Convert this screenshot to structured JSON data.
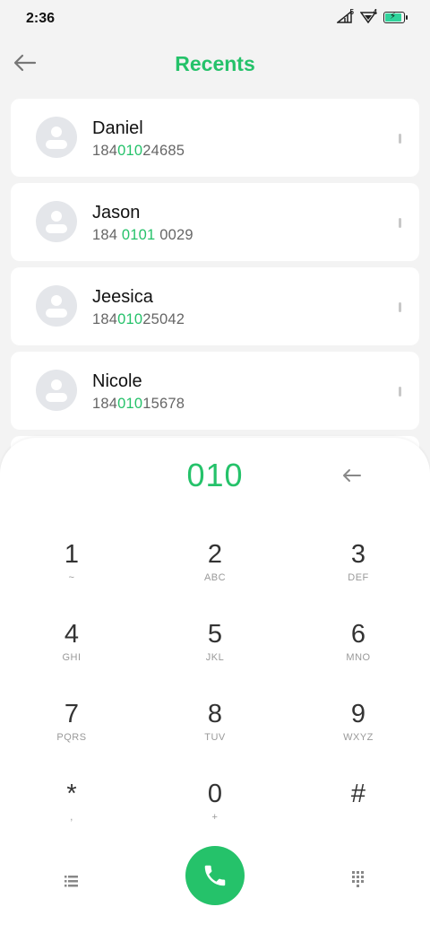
{
  "status": {
    "time": "2:36",
    "sim1_badge": "5",
    "sim2_badge": "4",
    "battery_level": 0.9
  },
  "header": {
    "title": "Recents"
  },
  "contacts": [
    {
      "name": "Daniel",
      "num_pre": "184",
      "num_match": "010",
      "num_post": "24685"
    },
    {
      "name": "Jason",
      "num_pre": "184 ",
      "num_match": "0101",
      "num_post": " 0029"
    },
    {
      "name": "Jeesica",
      "num_pre": "184",
      "num_match": "010",
      "num_post": "25042"
    },
    {
      "name": "Nicole",
      "num_pre": "184",
      "num_match": "010",
      "num_post": "15678"
    }
  ],
  "dialer": {
    "number": "010",
    "keys": [
      {
        "digit": "1",
        "letters": "~"
      },
      {
        "digit": "2",
        "letters": "ABC"
      },
      {
        "digit": "3",
        "letters": "DEF"
      },
      {
        "digit": "4",
        "letters": "GHI"
      },
      {
        "digit": "5",
        "letters": "JKL"
      },
      {
        "digit": "6",
        "letters": "MNO"
      },
      {
        "digit": "7",
        "letters": "PQRS"
      },
      {
        "digit": "8",
        "letters": "TUV"
      },
      {
        "digit": "9",
        "letters": "WXYZ"
      },
      {
        "digit": "*",
        "letters": ","
      },
      {
        "digit": "0",
        "letters": "+"
      },
      {
        "digit": "#",
        "letters": ""
      }
    ]
  },
  "icons": {
    "back": "arrow-left-icon",
    "delete": "backspace-arrow-icon",
    "menu": "list-icon",
    "call": "phone-icon",
    "grid": "dialpad-grid-icon"
  },
  "colors": {
    "accent": "#25c26a",
    "battery": "#2fd39b"
  }
}
